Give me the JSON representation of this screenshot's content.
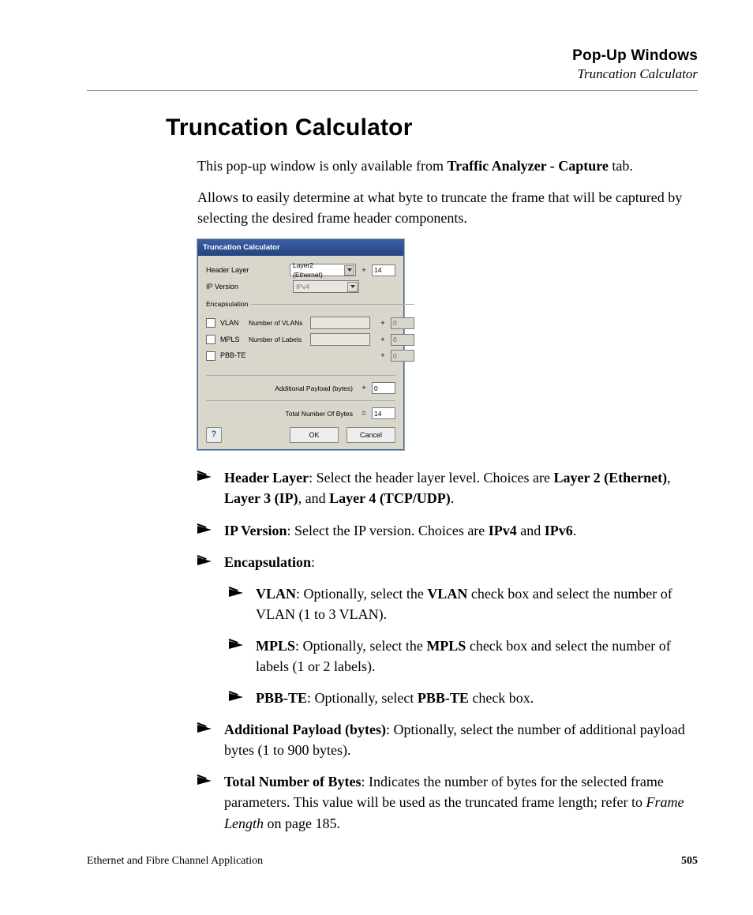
{
  "header": {
    "title": "Pop-Up Windows",
    "subtitle": "Truncation Calculator"
  },
  "h1": "Truncation Calculator",
  "intro": {
    "p1a": "This pop-up window is only available from ",
    "p1b": "Traffic Analyzer - Capture",
    "p1c": " tab.",
    "p2": "Allows to easily determine at what byte to truncate the frame that will be captured by selecting the desired frame header components."
  },
  "shot": {
    "title": "Truncation Calculator",
    "header_layer_label": "Header Layer",
    "header_layer_value": "Layer2 (Ethernet)",
    "header_layer_bytes": "14",
    "ip_version_label": "IP Version",
    "ip_version_value": "IPv4",
    "encapsulation_legend": "Encapsulation",
    "vlan_label": "VLAN",
    "vlan_count_label": "Number of VLANs",
    "vlan_bytes": "0",
    "mpls_label": "MPLS",
    "mpls_count_label": "Number of Labels",
    "mpls_bytes": "0",
    "pbbte_label": "PBB-TE",
    "pbbte_bytes": "0",
    "addl_label": "Additional Payload (bytes)",
    "addl_value": "0",
    "total_label": "Total Number Of Bytes",
    "total_value": "14",
    "ok": "OK",
    "cancel": "Cancel",
    "help": "?"
  },
  "bullets": {
    "b1": {
      "bold": "Header Layer",
      "text": ": Select the header layer level. Choices are ",
      "o1": "Layer 2 (Ethernet)",
      "c1": ", ",
      "o2": "Layer 3 (IP)",
      "c2": ", and ",
      "o3": "Layer 4 (TCP/UDP)",
      "end": "."
    },
    "b2": {
      "bold": "IP Version",
      "text": ": Select the IP version. Choices are ",
      "o1": "IPv4",
      "c1": " and ",
      "o2": "IPv6",
      "end": "."
    },
    "b3": {
      "bold": "Encapsulation",
      "end": ":"
    },
    "b3a": {
      "bold": "VLAN",
      "t1": ": Optionally, select the ",
      "b2": "VLAN",
      "t2": " check box and select the number of VLAN (1 to 3 VLAN)."
    },
    "b3b": {
      "bold": "MPLS",
      "t1": ": Optionally, select the ",
      "b2": "MPLS",
      "t2": " check box and select the number of labels (1 or 2 labels)."
    },
    "b3c": {
      "bold": "PBB-TE",
      "t1": ": Optionally, select ",
      "b2": "PBB-TE",
      "t2": " check box."
    },
    "b4": {
      "bold": "Additional Payload (bytes)",
      "text": ": Optionally, select the number of additional payload bytes (1 to 900 bytes)."
    },
    "b5": {
      "bold": "Total Number of Bytes",
      "t1": ": Indicates the number of bytes for the selected frame parameters. This value will be used as the truncated frame length; refer to ",
      "em": "Frame Length",
      "t2": " on page 185."
    }
  },
  "footer": {
    "left": "Ethernet and Fibre Channel Application",
    "page": "505"
  }
}
